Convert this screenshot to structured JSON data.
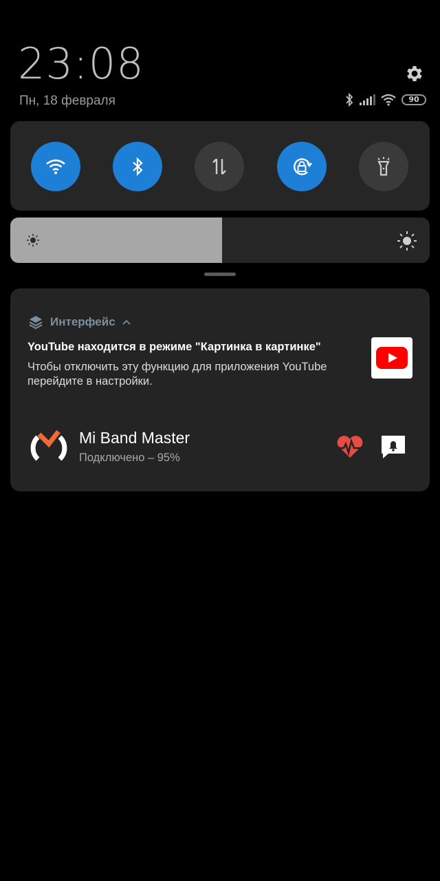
{
  "status": {
    "time": "23:08",
    "date": "Пн, 18 февраля",
    "battery_level": "90",
    "icons": [
      "bluetooth-icon",
      "signal-icon",
      "wifi-icon",
      "battery-icon"
    ]
  },
  "quick_toggles": [
    {
      "name": "wifi",
      "icon": "wifi-icon",
      "state": "on"
    },
    {
      "name": "bluetooth",
      "icon": "bluetooth-icon",
      "state": "on"
    },
    {
      "name": "mobile-data",
      "icon": "data-arrows-icon",
      "state": "off"
    },
    {
      "name": "rotation-lock",
      "icon": "rotation-lock-icon",
      "state": "on"
    },
    {
      "name": "flashlight",
      "icon": "flashlight-icon",
      "state": "off"
    }
  ],
  "brightness": {
    "level": 0.505
  },
  "notifications": {
    "system": {
      "app_name": "Интерфейс",
      "title": "YouTube находится в режиме \"Картинка в картинке\"",
      "text": "Чтобы отключить эту функцию для приложения YouTube перейдите в настройки.",
      "thumbnail_icon": "youtube-icon"
    },
    "miband": {
      "title": "Mi Band Master",
      "subtitle": "Подключено – 95%",
      "actions": [
        "heart-rate-icon",
        "bell-icon"
      ]
    }
  },
  "colors": {
    "accent": "#1e7fd6",
    "toggle_off": "#3a3a3a",
    "panel": "#262626",
    "youtube_red": "#ff0000",
    "heart_red": "#e84a44",
    "miband_orange": "#f06a35"
  }
}
